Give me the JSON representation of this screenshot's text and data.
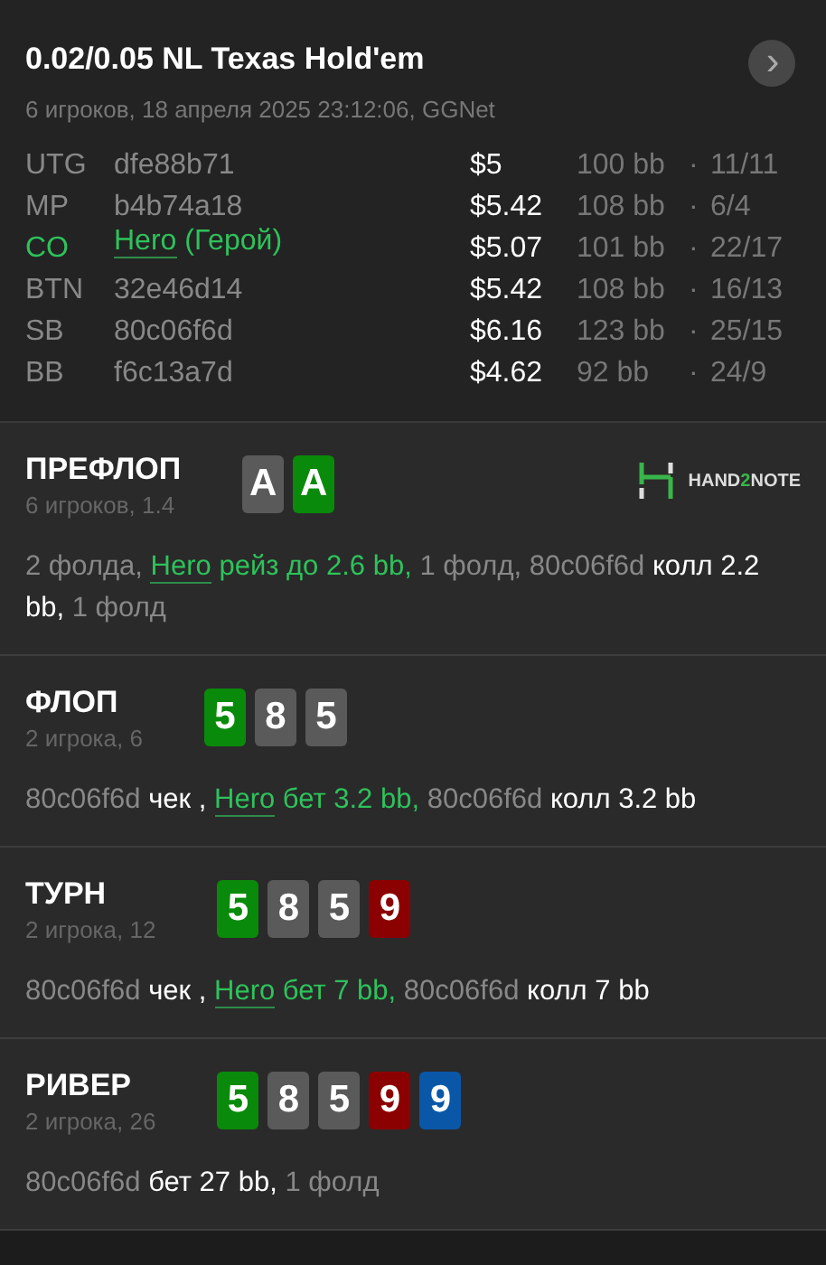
{
  "header": {
    "title": "0.02/0.05 NL Texas Hold'em",
    "subtitle": "6 игроков, 18 апреля 2025 23:12:06, GGNet",
    "next_button": "›"
  },
  "players": [
    {
      "position": "UTG",
      "name": "dfe88b71",
      "hero": false,
      "stack": "$5",
      "bb": "100 bb",
      "separator": "·",
      "stats": "11/11"
    },
    {
      "position": "MP",
      "name": "b4b74a18",
      "hero": false,
      "stack": "$5.42",
      "bb": "108 bb",
      "separator": "·",
      "stats": "6/4"
    },
    {
      "position": "CO",
      "name": "Hero",
      "name_note": "(Герой)",
      "hero": true,
      "stack": "$5.07",
      "bb": "101 bb",
      "separator": "·",
      "stats": "22/17"
    },
    {
      "position": "BTN",
      "name": "32e46d14",
      "hero": false,
      "stack": "$5.42",
      "bb": "108 bb",
      "separator": "·",
      "stats": "16/13"
    },
    {
      "position": "SB",
      "name": "80c06f6d",
      "hero": false,
      "stack": "$6.16",
      "bb": "123 bb",
      "separator": "·",
      "stats": "25/15"
    },
    {
      "position": "BB",
      "name": "f6c13a7d",
      "hero": false,
      "stack": "$4.62",
      "bb": "92 bb",
      "separator": "·",
      "stats": "24/9"
    }
  ],
  "streets": [
    {
      "name": "ПРЕФЛОП",
      "info": "6 игроков, 1.4",
      "logo": {
        "before": "HAND",
        "accent": "2",
        "after": "NOTE"
      },
      "cards": [
        {
          "rank": "A",
          "color": "#5a5a5a"
        },
        {
          "rank": "A",
          "color": "#0a8a0a"
        }
      ],
      "actions": [
        {
          "kind": "muted",
          "text": "2 фолда, "
        },
        {
          "kind": "hero",
          "text": "Hero"
        },
        {
          "kind": "hero_action",
          "text": " рейз до 2.6 bb,"
        },
        {
          "kind": "muted",
          "text": " 1 фолд, 80c06f6d "
        },
        {
          "kind": "action",
          "text": "колл 2.2 bb,"
        },
        {
          "kind": "muted",
          "text": " 1 фолд"
        }
      ]
    },
    {
      "name": "ФЛОП",
      "info": "2 игрока, 6",
      "cards": [
        {
          "rank": "5",
          "color": "#0a8a0a"
        },
        {
          "rank": "8",
          "color": "#5a5a5a"
        },
        {
          "rank": "5",
          "color": "#5a5a5a"
        }
      ],
      "actions": [
        {
          "kind": "muted",
          "text": "80c06f6d "
        },
        {
          "kind": "action",
          "text": "чек , "
        },
        {
          "kind": "hero",
          "text": "Hero"
        },
        {
          "kind": "hero_action",
          "text": " бет 3.2 bb,"
        },
        {
          "kind": "muted",
          "text": " 80c06f6d "
        },
        {
          "kind": "action",
          "text": "колл 3.2 bb"
        }
      ]
    },
    {
      "name": "ТУРН",
      "info": "2 игрока, 12",
      "cards": [
        {
          "rank": "5",
          "color": "#0a8a0a"
        },
        {
          "rank": "8",
          "color": "#5a5a5a"
        },
        {
          "rank": "5",
          "color": "#5a5a5a"
        },
        {
          "rank": "9",
          "color": "#8b0000"
        }
      ],
      "actions": [
        {
          "kind": "muted",
          "text": "80c06f6d "
        },
        {
          "kind": "action",
          "text": "чек , "
        },
        {
          "kind": "hero",
          "text": "Hero"
        },
        {
          "kind": "hero_action",
          "text": " бет 7 bb,"
        },
        {
          "kind": "muted",
          "text": " 80c06f6d "
        },
        {
          "kind": "action",
          "text": "колл 7 bb"
        }
      ]
    },
    {
      "name": "РИВЕР",
      "info": "2 игрока, 26",
      "cards": [
        {
          "rank": "5",
          "color": "#0a8a0a"
        },
        {
          "rank": "8",
          "color": "#5a5a5a"
        },
        {
          "rank": "5",
          "color": "#5a5a5a"
        },
        {
          "rank": "9",
          "color": "#8b0000"
        },
        {
          "rank": "9",
          "color": "#0a57a8"
        }
      ],
      "actions": [
        {
          "kind": "muted",
          "text": "80c06f6d "
        },
        {
          "kind": "action",
          "text": "бет 27 bb,"
        },
        {
          "kind": "muted",
          "text": " 1 фолд"
        }
      ]
    }
  ]
}
